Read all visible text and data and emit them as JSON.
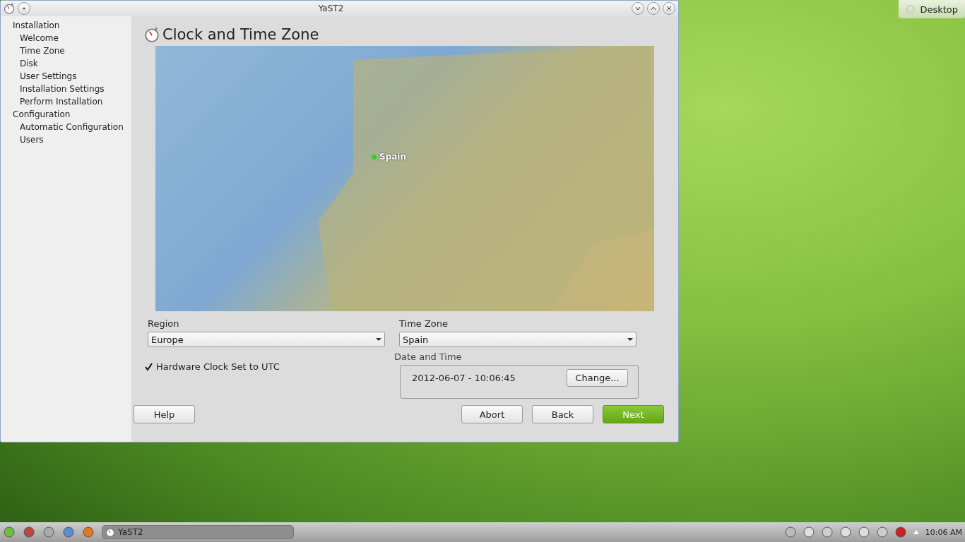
{
  "window": {
    "title": "YaST2"
  },
  "sidebar": {
    "groups": [
      {
        "label": "Installation",
        "children": [
          {
            "label": "Welcome"
          },
          {
            "label": "Time Zone"
          },
          {
            "label": "Disk"
          },
          {
            "label": "User Settings"
          },
          {
            "label": "Installation Settings"
          },
          {
            "label": "Perform Installation"
          }
        ]
      },
      {
        "label": "Configuration",
        "children": [
          {
            "label": "Automatic Configuration"
          },
          {
            "label": "Users"
          }
        ]
      }
    ]
  },
  "heading": "Clock and Time Zone",
  "map": {
    "marker_label": "Spain"
  },
  "region": {
    "label": "Region",
    "value": "Europe"
  },
  "time_zone": {
    "label": "Time Zone",
    "value": "Spain"
  },
  "hardware_clock": {
    "label": "Hardware Clock Set to UTC",
    "checked": true
  },
  "date_time": {
    "title": "Date and Time",
    "value": "2012-06-07 - 10:06:45",
    "button": "Change..."
  },
  "buttons": [
    {
      "label": "Help",
      "kind": "plain"
    },
    {
      "label": "Abort",
      "kind": "plain"
    },
    {
      "label": "Back",
      "kind": "plain"
    },
    {
      "label": "Next",
      "kind": "primary"
    }
  ],
  "desktop": {
    "button": "Desktop"
  },
  "taskbar": {
    "task": "YaST2",
    "clock": "10:06 AM"
  }
}
